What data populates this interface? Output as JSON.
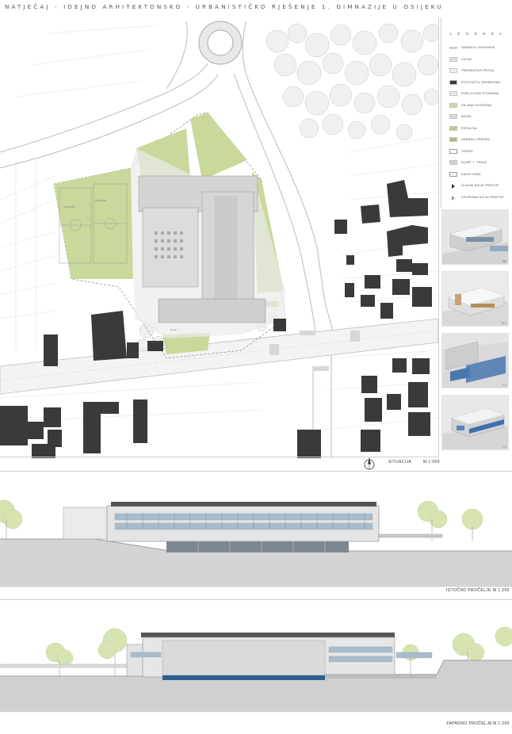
{
  "header": {
    "title": "NATJEČAJ - IDEJNO ARHITEKTONSKO - URBANISTIČKO RJEŠENJE 1. GIMNAZIJE U OSIJEKU"
  },
  "site_plan": {
    "title": "SITUACIJA",
    "scale": "M 1:000"
  },
  "legend": {
    "heading": "L E G E N D A",
    "items": [
      {
        "label": "GRANICA OBUHVATA",
        "color": "#ffffff",
        "style": "dashed"
      },
      {
        "label": "CESTA",
        "color": "#dcdcdc",
        "style": "fill"
      },
      {
        "label": "TRAVNJAČKA PRUGA",
        "color": "#efefef",
        "style": "fill"
      },
      {
        "label": "POSTOJEĆA GRAĐEVINA",
        "color": "#3a3a3a",
        "style": "fill"
      },
      {
        "label": "PORLOČENA POVRŠINA",
        "color": "#e6e6e6",
        "style": "fill"
      },
      {
        "label": "ZELENA POVRŠINA",
        "color": "#c9d89b",
        "style": "fill"
      },
      {
        "label": "BICIKL",
        "color": "#d8d8d8",
        "style": "fill"
      },
      {
        "label": "PJEŠAČKA",
        "color": "#b9cc86",
        "style": "fill"
      },
      {
        "label": "URBANA OPREMA",
        "color": "#a9bf76",
        "style": "fill"
      },
      {
        "label": "TERENI",
        "color": "#ffffff",
        "style": "outline"
      },
      {
        "label": "KLUPE + TRAVA",
        "color": "#cfcfcf",
        "style": "fill"
      },
      {
        "label": "SKATE PARK",
        "color": "#f2f2f2",
        "style": "outline"
      },
      {
        "label": "GLAVNI KOLNI PRISTUP",
        "color": "#333333",
        "style": "arrow"
      },
      {
        "label": "SPOREDNI KOLNI PRISTUP",
        "color": "#999999",
        "style": "arrow"
      }
    ]
  },
  "renders": [
    {
      "label": "S2"
    },
    {
      "label": "S 1"
    },
    {
      "label": "I 2"
    },
    {
      "label": "I 1"
    }
  ],
  "elevations": [
    {
      "title": "ISTOČNO PROČELJE",
      "scale": "M 1:200"
    },
    {
      "title": "ZAPADNO PROČELJE",
      "scale": "M 1:200"
    }
  ],
  "colors": {
    "building": "#3a3a3a",
    "green": "#c9d89b",
    "road": "#dedede",
    "line": "#bdbdbd"
  }
}
